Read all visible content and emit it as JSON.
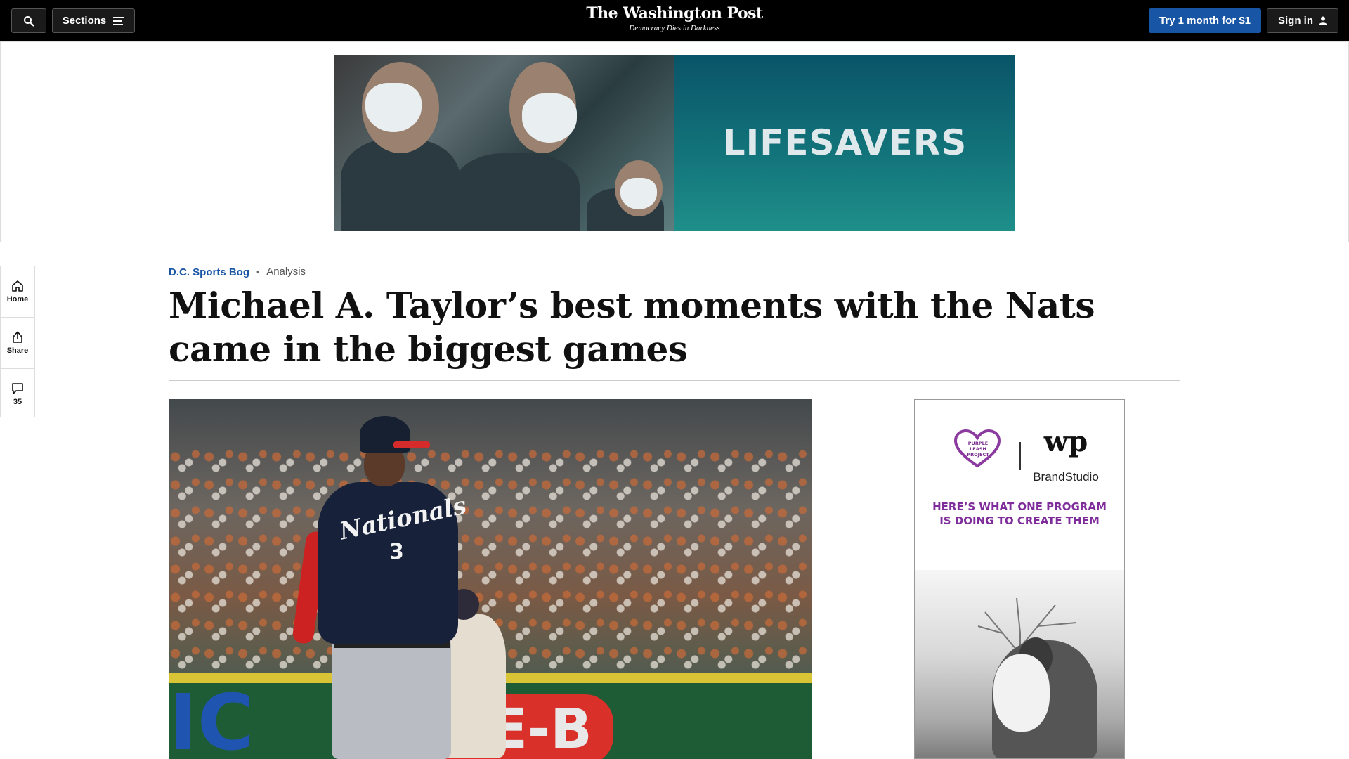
{
  "nav": {
    "sections_label": "Sections",
    "logo_name": "The Washington Post",
    "logo_tagline": "Democracy Dies in Darkness",
    "subscribe_label": "Try 1 month for $1",
    "signin_label": "Sign in"
  },
  "banner_ad": {
    "headline": "LIFESAVERS"
  },
  "left_rail": {
    "home_label": "Home",
    "share_label": "Share",
    "comments_count": "35"
  },
  "article": {
    "section": "D.C. Sports Bog",
    "label": "Analysis",
    "headline": "Michael A. Taylor’s best moments with the Nats came in the biggest games"
  },
  "lead_photo": {
    "jersey_text": "Nationals",
    "jersey_number": "3",
    "fence_ad_letters": "H-E-B"
  },
  "side_ad": {
    "partner_logo": "PURPLE LEASH PROJECT",
    "wp_mark": "wp",
    "brand_label": "BrandStudio",
    "headline": "HERE’S WHAT ONE PROGRAM IS DOING TO CREATE THEM"
  },
  "colors": {
    "nav_background": "#000000",
    "subscribe_button": "#1955a5",
    "section_link": "#1955a5",
    "ad_headline_purple": "#7e2d9b",
    "banner_teal": "#12737a"
  }
}
